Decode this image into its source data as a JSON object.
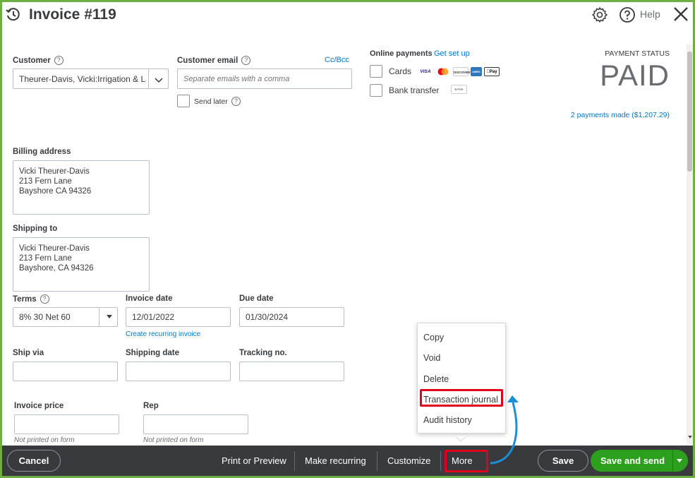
{
  "header": {
    "title": "Invoice #119",
    "help_label": "Help"
  },
  "customer": {
    "label": "Customer",
    "value": "Theurer-Davis, Vicki:Irrigation & La"
  },
  "customer_email": {
    "label": "Customer email",
    "placeholder": "Separate emails with a comma",
    "cc_bcc": "Cc/Bcc",
    "send_later": "Send later"
  },
  "online_payments": {
    "label": "Online payments",
    "setup_link": "Get set up",
    "cards_label": "Cards",
    "card_logos": [
      "VISA",
      "MC",
      "DISCOVER",
      "AMEX",
      "Pay"
    ],
    "bank_label": "Bank transfer",
    "bank_logo": "BANK"
  },
  "payment_status": {
    "label": "PAYMENT STATUS",
    "value": "PAID",
    "payments_link": "2 payments made ($1,207.29)"
  },
  "billing": {
    "label": "Billing address",
    "lines": [
      "Vicki Theurer-Davis",
      "213 Fern Lane",
      "Bayshore CA 94326"
    ]
  },
  "shipping": {
    "label": "Shipping to",
    "lines": [
      "Vicki Theurer-Davis",
      "213 Fern Lane",
      "Bayshore, CA  94326"
    ]
  },
  "terms": {
    "label": "Terms",
    "value": "8% 30 Net 60"
  },
  "invoice_date": {
    "label": "Invoice date",
    "value": "12/01/2022",
    "recurring_link": "Create recurring invoice"
  },
  "due_date": {
    "label": "Due date",
    "value": "01/30/2024"
  },
  "ship_via": {
    "label": "Ship via"
  },
  "shipping_date": {
    "label": "Shipping date"
  },
  "tracking": {
    "label": "Tracking no."
  },
  "invoice_price": {
    "label": "Invoice price",
    "note": "Not printed on form"
  },
  "rep": {
    "label": "Rep",
    "note": "Not printed on form"
  },
  "more_menu": {
    "items": [
      "Copy",
      "Void",
      "Delete",
      "Transaction journal",
      "Audit history"
    ]
  },
  "footer": {
    "cancel": "Cancel",
    "print_preview": "Print or Preview",
    "make_recurring": "Make recurring",
    "customize": "Customize",
    "more": "More",
    "save": "Save",
    "save_and_send": "Save and send"
  },
  "colors": {
    "brand_green": "#2ca01c",
    "frame_green": "#6eaf45",
    "link_blue": "#0077c5",
    "highlight_red": "#e0001b",
    "arrow_blue": "#1a8fd6",
    "footer_dark": "#393a3d"
  }
}
